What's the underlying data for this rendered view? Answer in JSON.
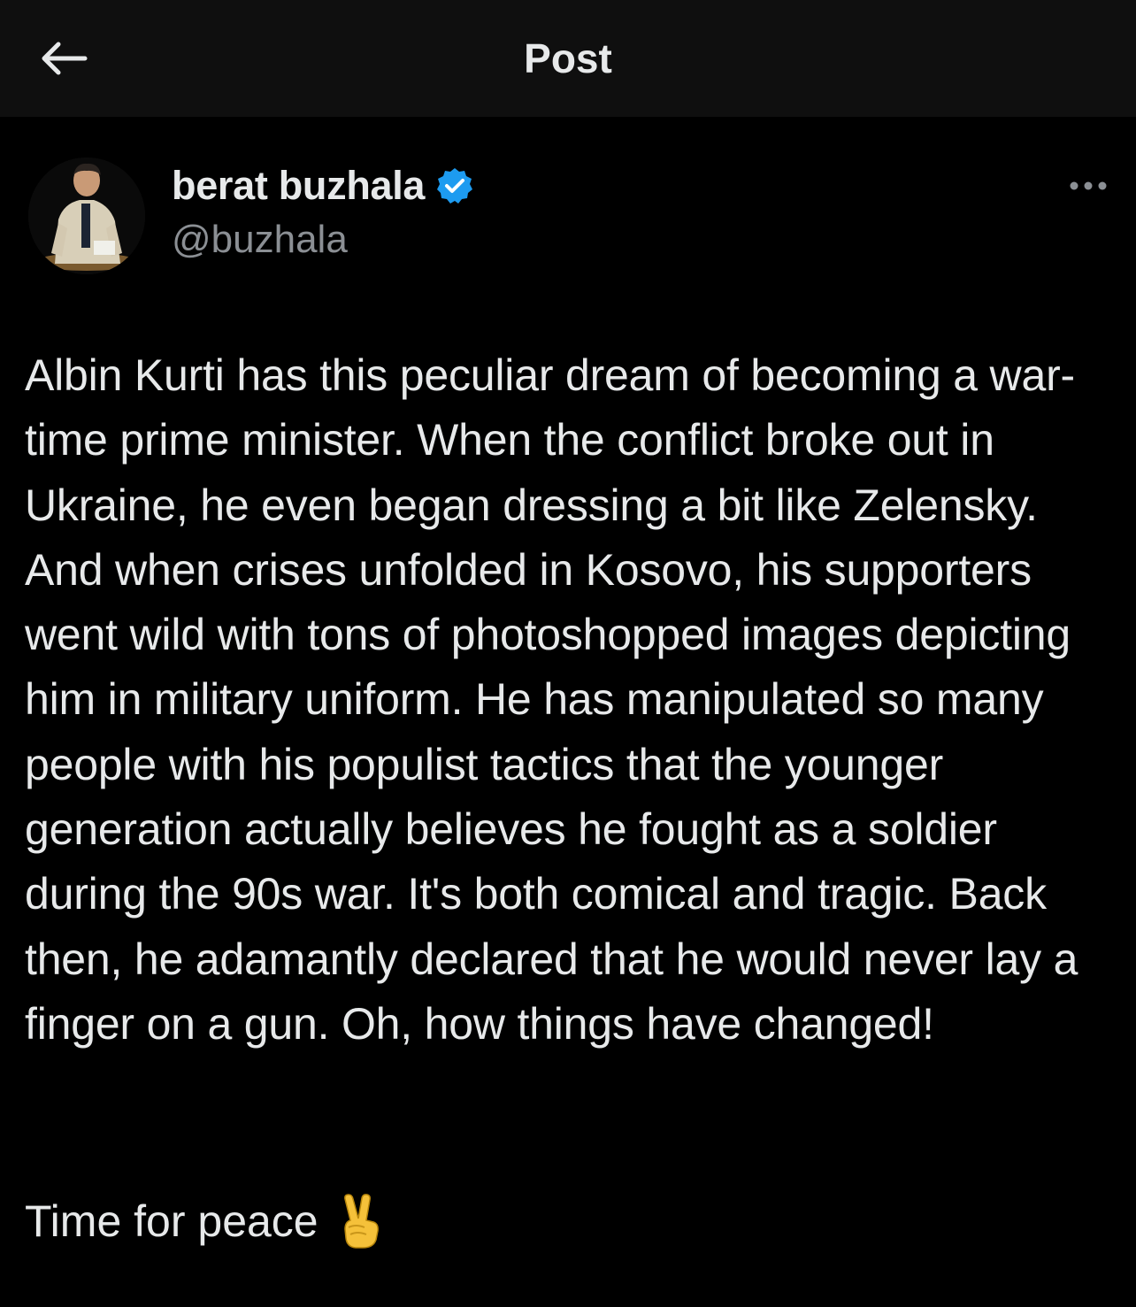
{
  "header": {
    "title": "Post",
    "back_icon": "arrow-left-icon"
  },
  "author": {
    "display_name": "berat buzhala",
    "handle": "@buzhala",
    "verified": true,
    "verified_icon": "verified-badge-icon",
    "verified_color": "#1d9bf0"
  },
  "post": {
    "body": "Albin Kurti has this peculiar dream of becoming a war-time prime minister. When the conflict broke out in Ukraine, he even began dressing a bit like Zelensky. And when crises unfolded in Kosovo, his supporters went wild with tons of photoshopped images depicting him in military uniform. He has manipulated so many people with his populist tactics that the younger generation actually believes he fought as a soldier during the 90s war. It's both comical and tragic. Back then, he adamantly declared that he would never lay a finger on a gun. Oh, how things have changed!",
    "closing": "Time for peace",
    "closing_icon": "victory-hand-emoji-icon"
  },
  "actions": {
    "more_icon": "more-options-icon"
  },
  "colors": {
    "background": "#000000",
    "header_background": "#0f0f0f",
    "text_primary": "#e7e9ea",
    "text_secondary": "#8b8f94"
  }
}
